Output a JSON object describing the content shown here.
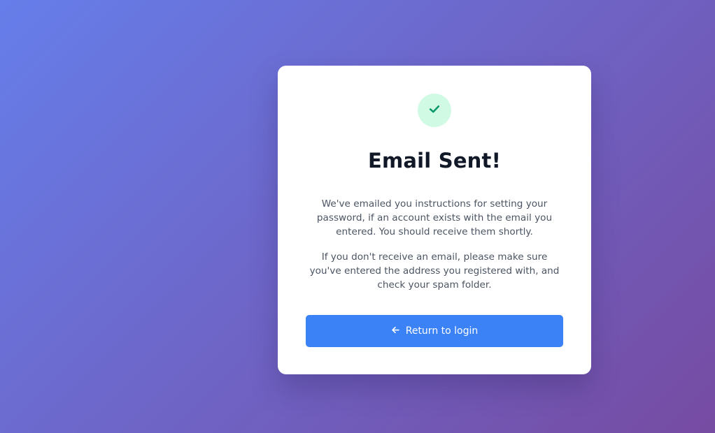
{
  "card": {
    "icon": "check-icon",
    "title": "Email Sent!",
    "message_1": "We've emailed you instructions for setting your password, if an account exists with the email you entered. You should receive them shortly.",
    "message_2": "If you don't receive an email, please make sure you've entered the address you registered with, and check your spam folder.",
    "button": {
      "icon": "arrow-left-icon",
      "label": "Return to login"
    }
  },
  "colors": {
    "background_gradient_start": "#667eea",
    "background_gradient_end": "#764ba2",
    "success_circle": "#d1fae5",
    "success_check": "#059669",
    "button": "#3b82f6",
    "title_text": "#111827",
    "body_text": "#4b5563"
  }
}
